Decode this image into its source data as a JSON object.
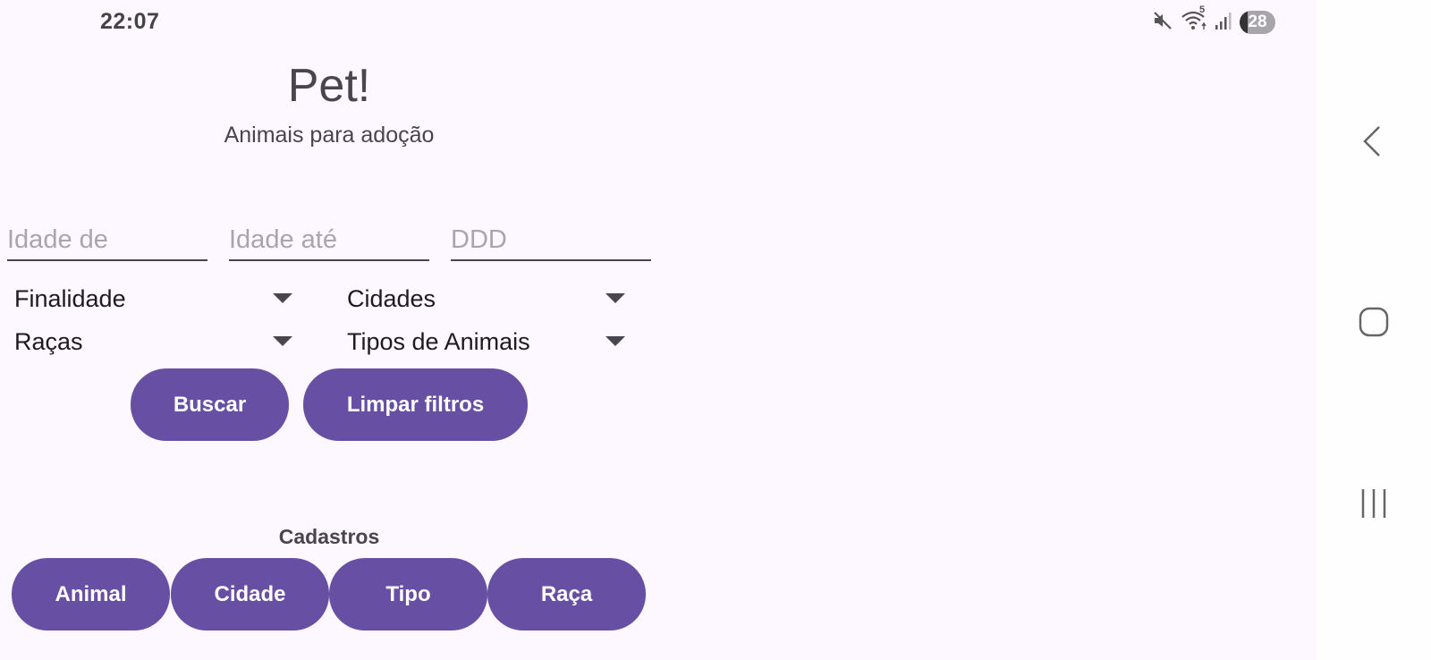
{
  "status_bar": {
    "time": "22:07",
    "wifi_label": "5",
    "battery": "28"
  },
  "header": {
    "title": "Pet!",
    "subtitle": "Animais para adoção"
  },
  "filters": {
    "age_from_placeholder": "Idade de",
    "age_to_placeholder": "Idade até",
    "ddd_placeholder": "DDD",
    "finalidade": "Finalidade",
    "cidades": "Cidades",
    "racas": "Raças",
    "tipos": "Tipos de Animais"
  },
  "actions": {
    "search": "Buscar",
    "clear": "Limpar filtros"
  },
  "registrations": {
    "label": "Cadastros",
    "animal": "Animal",
    "cidade": "Cidade",
    "tipo": "Tipo",
    "raca": "Raça"
  },
  "colors": {
    "primary": "#6750a4",
    "background": "#fdf7ff"
  },
  "icons": [
    "mute-icon",
    "wifi-icon",
    "signal-icon",
    "battery-icon",
    "back-icon",
    "home-icon",
    "recents-icon"
  ]
}
